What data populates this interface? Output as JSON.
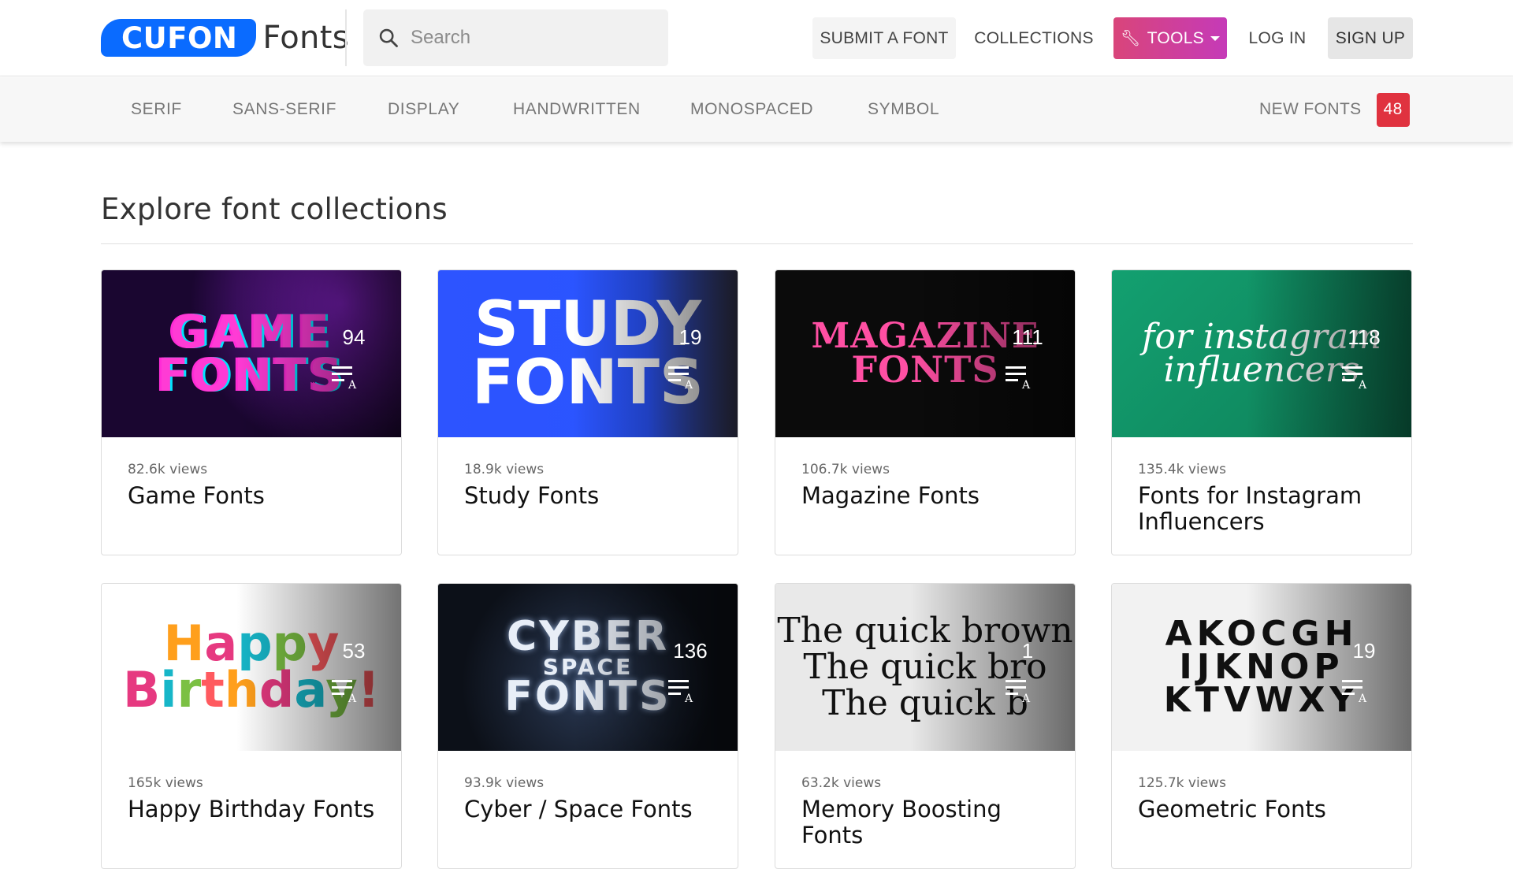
{
  "brand": {
    "logo_pill": "CUFON",
    "logo_word": "Fonts"
  },
  "search": {
    "placeholder": "Search"
  },
  "nav": {
    "submit": "SUBMIT A FONT",
    "collections": "COLLECTIONS",
    "tools": "TOOLS",
    "login": "LOG IN",
    "signup": "SIGN UP"
  },
  "categories": [
    "SERIF",
    "SANS-SERIF",
    "DISPLAY",
    "HANDWRITTEN",
    "MONOSPACED",
    "SYMBOL"
  ],
  "new_fonts": {
    "label": "NEW FONTS",
    "count": "48"
  },
  "page": {
    "title": "Explore font collections"
  },
  "collections": [
    {
      "title": "Game Fonts",
      "views": "82.6k views",
      "count": "94",
      "art": [
        "GAME",
        "FONTS"
      ],
      "bg": "#1a0630",
      "accent": "#ff3bd5"
    },
    {
      "title": "Study Fonts",
      "views": "18.9k views",
      "count": "19",
      "art": [
        "STUDY",
        "FONTS"
      ],
      "bg": "#2a55ff",
      "accent": "#ffffff"
    },
    {
      "title": "Magazine Fonts",
      "views": "106.7k views",
      "count": "111",
      "art": [
        "MAGAZINE",
        "FONTS"
      ],
      "bg": "#0b0b0b",
      "accent": "#ff4fa3"
    },
    {
      "title": "Fonts for Instagram Influencers",
      "views": "135.4k views",
      "count": "118",
      "art": [
        "for instagram",
        "influencers"
      ],
      "bg": "#0f8a5f",
      "accent": "#ffffff"
    },
    {
      "title": "Happy Birthday Fonts",
      "views": "165k views",
      "count": "53",
      "art": [
        "Happy",
        "Birthday!"
      ],
      "bg": "#ffffff",
      "accent": "#ff7a00"
    },
    {
      "title": "Cyber / Space Fonts",
      "views": "93.9k views",
      "count": "136",
      "art": [
        "CYBER",
        "SPACE",
        "FONTS"
      ],
      "bg": "#10151f",
      "accent": "#e8eef7"
    },
    {
      "title": "Memory Boosting Fonts",
      "views": "63.2k views",
      "count": "1",
      "art": [
        "The quick brown",
        "The quick bro",
        "The quick b"
      ],
      "bg": "#e7e7e7",
      "accent": "#111111"
    },
    {
      "title": "Geometric Fonts",
      "views": "125.7k views",
      "count": "19",
      "art": [
        "AKOCGH",
        "IJKNOP",
        "KTVWXY"
      ],
      "bg": "#f2f2f2",
      "accent": "#111111"
    }
  ]
}
